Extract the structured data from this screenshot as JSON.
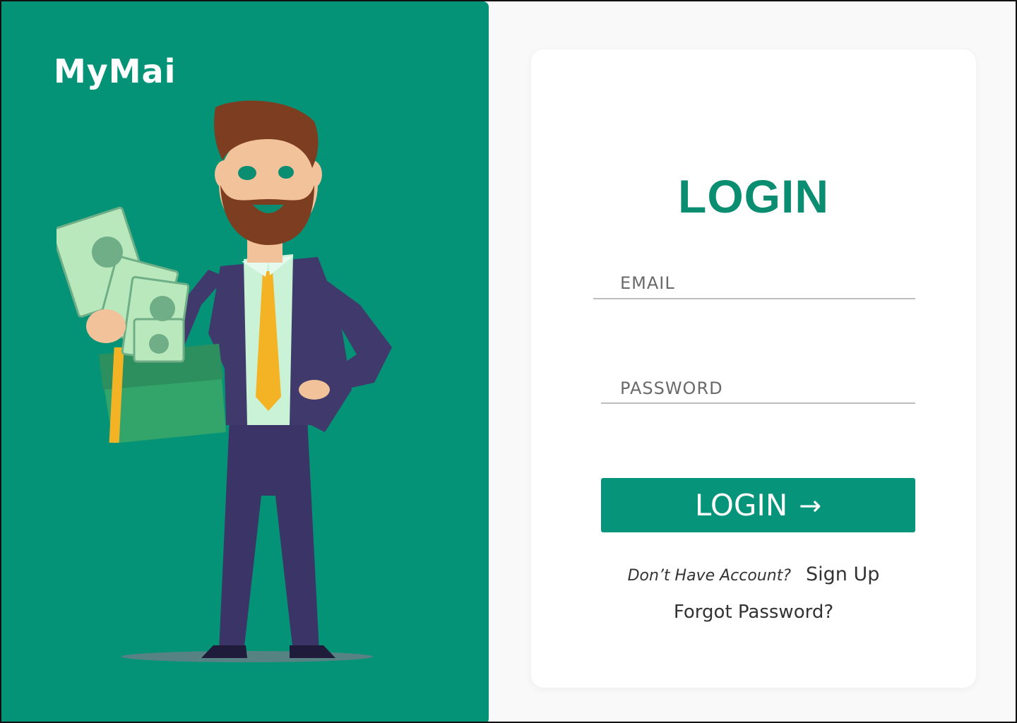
{
  "brand": {
    "name": "MyMai"
  },
  "colors": {
    "primary": "#059377",
    "title": "#0a8d70",
    "card": "#ffffff"
  },
  "login": {
    "title": "LOGIN",
    "email_placeholder": "EMAIL",
    "password_placeholder": "PASSWORD",
    "button_label": "LOGIN",
    "button_icon": "arrow-right-icon",
    "no_account_text": "Don’t Have Account?",
    "signup_label": "Sign Up",
    "forgot_label": "Forgot Password?"
  }
}
